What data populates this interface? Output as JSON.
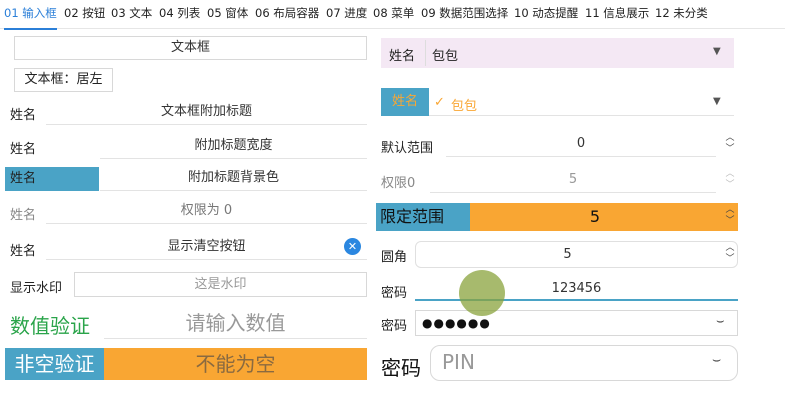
{
  "tabs": [
    {
      "label": "01 输入框"
    },
    {
      "label": "02 按钮"
    },
    {
      "label": "03 文本"
    },
    {
      "label": "04 列表"
    },
    {
      "label": "05 窗体"
    },
    {
      "label": "06 布局容器"
    },
    {
      "label": "07 进度"
    },
    {
      "label": "08 菜单"
    },
    {
      "label": "09 数据范围选择"
    },
    {
      "label": "10 动态提醒"
    },
    {
      "label": "11 信息展示"
    },
    {
      "label": "12 未分类"
    }
  ],
  "left": {
    "textbox": {
      "value": "文本框"
    },
    "align_label": "文本框：居左",
    "row1": {
      "label": "姓名",
      "value": "文本框附加标题"
    },
    "row2": {
      "label": "姓名",
      "value": "附加标题宽度"
    },
    "row3": {
      "label": "姓名",
      "value": "附加标题背景色"
    },
    "row4": {
      "label": "姓名",
      "value": "权限为 0"
    },
    "row5": {
      "label": "姓名",
      "value": "显示清空按钮",
      "clear_icon": "close-icon"
    },
    "watermark": {
      "label": "显示水印",
      "placeholder": "这是水印"
    },
    "numeric": {
      "label": "数值验证",
      "placeholder": "请输入数值"
    },
    "required": {
      "label": "非空验证",
      "placeholder": "不能为空"
    }
  },
  "right": {
    "combo1": {
      "label": "姓名",
      "value": "包包"
    },
    "combo2": {
      "label": "姓名",
      "value": "包包",
      "check": "✓"
    },
    "default_range": {
      "label": "默认范围",
      "value": "0"
    },
    "permission": {
      "label": "权限0",
      "value": "5"
    },
    "limit_range": {
      "label": "限定范围",
      "value": "5"
    },
    "corner": {
      "label": "圆角",
      "value": "5"
    },
    "password1": {
      "label": "密码",
      "value": "123456"
    },
    "password2": {
      "label": "密码",
      "value": "●●●●●●"
    },
    "pin": {
      "label": "密码",
      "placeholder": "PIN"
    }
  },
  "colors": {
    "accent_blue": "#4aa3c6",
    "orange": "#f9a633",
    "green": "#2aa44a",
    "combo_pink": "#f4e8f4",
    "tab_active": "#2b7fd8"
  }
}
